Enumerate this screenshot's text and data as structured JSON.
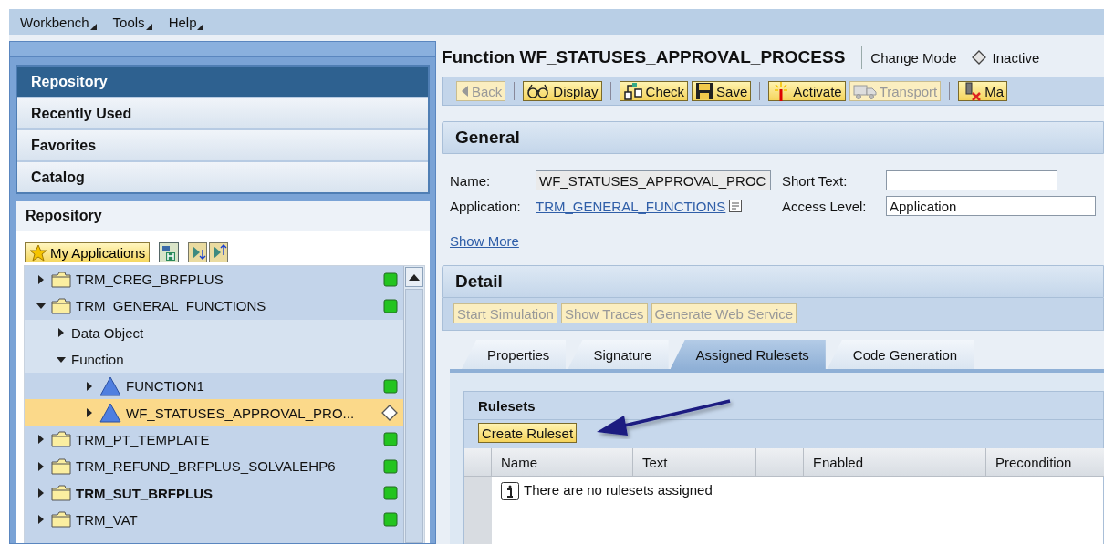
{
  "menu": [
    {
      "label": "Workbench"
    },
    {
      "label": "Tools"
    },
    {
      "label": "Help"
    }
  ],
  "nav": {
    "items": [
      {
        "label": "Repository",
        "selected": true
      },
      {
        "label": "Recently Used",
        "selected": false
      },
      {
        "label": "Favorites",
        "selected": false
      },
      {
        "label": "Catalog",
        "selected": false
      }
    ],
    "section_title": "Repository",
    "my_applications": "My Applications",
    "tree": [
      {
        "label": "TRM_CREG_BRFPLUS",
        "kind": "folder",
        "expanded": false,
        "selected": false,
        "bold": false,
        "active": true
      },
      {
        "label": "TRM_GENERAL_FUNCTIONS",
        "kind": "folder",
        "expanded": true,
        "selected": false,
        "bold": false,
        "active": true,
        "children": [
          {
            "label": "Data Object",
            "kind": "category",
            "expanded": false,
            "selected": false,
            "bold": false
          },
          {
            "label": "Function",
            "kind": "category",
            "expanded": true,
            "selected": false,
            "bold": false,
            "children": [
              {
                "label": "FUNCTION1",
                "kind": "function",
                "expanded": false,
                "selected": false,
                "bold": false,
                "active": true
              },
              {
                "label": "WF_STATUSES_APPROVAL_PRO...",
                "kind": "function",
                "expanded": false,
                "selected": true,
                "bold": false,
                "active": false
              }
            ]
          }
        ]
      },
      {
        "label": "TRM_PT_TEMPLATE",
        "kind": "folder",
        "expanded": false,
        "selected": false,
        "bold": false,
        "active": true
      },
      {
        "label": "TRM_REFUND_BRFPLUS_SOLVALEHP6",
        "kind": "folder",
        "expanded": false,
        "selected": false,
        "bold": false,
        "active": true
      },
      {
        "label": "TRM_SUT_BRFPLUS",
        "kind": "folder",
        "expanded": false,
        "selected": false,
        "bold": true,
        "active": true
      },
      {
        "label": "TRM_VAT",
        "kind": "folder",
        "expanded": false,
        "selected": false,
        "bold": false,
        "active": true
      }
    ]
  },
  "editor": {
    "title": "Function WF_STATUSES_APPROVAL_PROCESS",
    "mode": "Change Mode",
    "status": "Inactive",
    "toolbar": [
      {
        "label": "Back",
        "kind": "back",
        "disabled": true
      },
      {
        "label": "Display",
        "kind": "display",
        "disabled": false
      },
      {
        "label": "Check",
        "kind": "check",
        "disabled": false
      },
      {
        "label": "Save",
        "kind": "save",
        "disabled": false
      },
      {
        "label": "Activate",
        "kind": "activate",
        "disabled": false
      },
      {
        "label": "Transport",
        "kind": "transport",
        "disabled": true
      },
      {
        "label": "Ma",
        "kind": "more",
        "disabled": false
      }
    ],
    "general": {
      "title": "General",
      "name": {
        "label": "Name:",
        "value": "WF_STATUSES_APPROVAL_PROC"
      },
      "short_text": {
        "label": "Short Text:"
      },
      "application": {
        "label": "Application:",
        "value": "TRM_GENERAL_FUNCTIONS"
      },
      "access_level": {
        "label": "Access Level:",
        "value": "Application"
      },
      "show_more": "Show More"
    },
    "detail": {
      "title": "Detail",
      "buttons": [
        {
          "label": "Start Simulation",
          "disabled": true
        },
        {
          "label": "Show Traces",
          "disabled": true
        },
        {
          "label": "Generate Web Service",
          "disabled": true
        }
      ],
      "tabs": [
        {
          "label": "Properties",
          "selected": false
        },
        {
          "label": "Signature",
          "selected": false
        },
        {
          "label": "Assigned Rulesets",
          "selected": true
        },
        {
          "label": "Code Generation",
          "selected": false
        }
      ],
      "rulesets": {
        "title": "Rulesets",
        "create_button": "Create Ruleset",
        "columns": [
          {
            "label": "Name"
          },
          {
            "label": "Text"
          },
          {},
          {
            "label": "Enabled"
          },
          {
            "label": "Precondition"
          }
        ],
        "empty_message": "There are no rulesets assigned"
      }
    }
  }
}
